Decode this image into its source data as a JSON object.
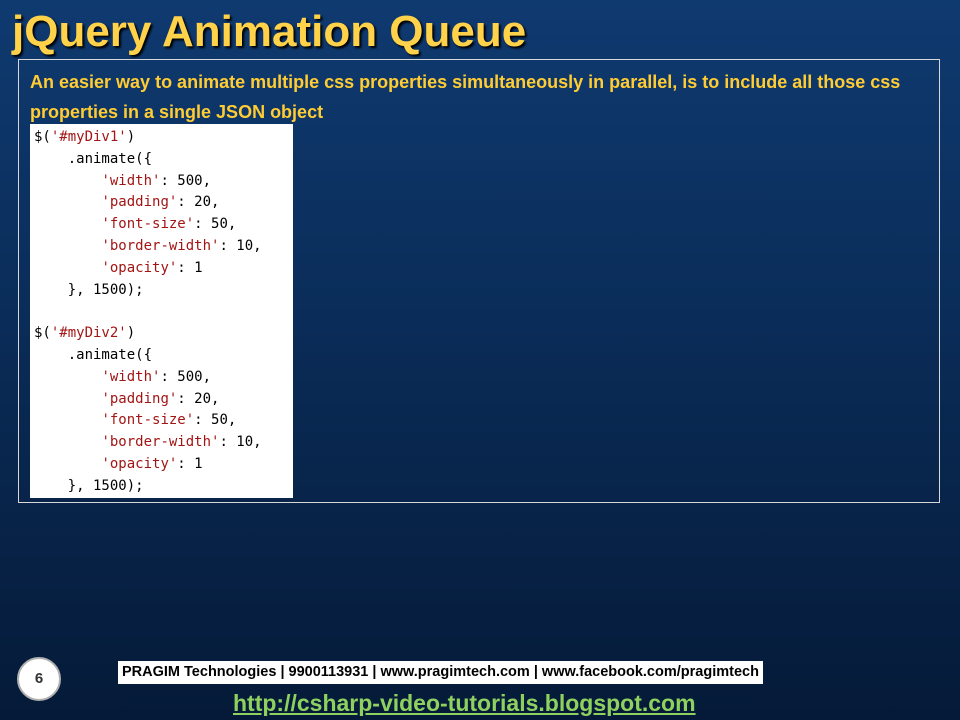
{
  "slide": {
    "title": "jQuery Animation Queue",
    "intro": "An easier way to animate multiple css properties simultaneously in parallel, is to include all those css properties in a single JSON object",
    "code_lines": [
      [
        {
          "t": "$("
        },
        {
          "t": "'#myDiv1'",
          "s": true
        },
        {
          "t": ")"
        }
      ],
      [
        {
          "t": "    .animate({"
        }
      ],
      [
        {
          "t": "        "
        },
        {
          "t": "'width'",
          "s": true
        },
        {
          "t": ": 500,"
        }
      ],
      [
        {
          "t": "        "
        },
        {
          "t": "'padding'",
          "s": true
        },
        {
          "t": ": 20,"
        }
      ],
      [
        {
          "t": "        "
        },
        {
          "t": "'font-size'",
          "s": true
        },
        {
          "t": ": 50,"
        }
      ],
      [
        {
          "t": "        "
        },
        {
          "t": "'border-width'",
          "s": true
        },
        {
          "t": ": 10,"
        }
      ],
      [
        {
          "t": "        "
        },
        {
          "t": "'opacity'",
          "s": true
        },
        {
          "t": ": 1"
        }
      ],
      [
        {
          "t": "    }, 1500);"
        }
      ],
      [],
      [
        {
          "t": "$("
        },
        {
          "t": "'#myDiv2'",
          "s": true
        },
        {
          "t": ")"
        }
      ],
      [
        {
          "t": "    .animate({"
        }
      ],
      [
        {
          "t": "        "
        },
        {
          "t": "'width'",
          "s": true
        },
        {
          "t": ": 500,"
        }
      ],
      [
        {
          "t": "        "
        },
        {
          "t": "'padding'",
          "s": true
        },
        {
          "t": ": 20,"
        }
      ],
      [
        {
          "t": "        "
        },
        {
          "t": "'font-size'",
          "s": true
        },
        {
          "t": ": 50,"
        }
      ],
      [
        {
          "t": "        "
        },
        {
          "t": "'border-width'",
          "s": true
        },
        {
          "t": ": 10,"
        }
      ],
      [
        {
          "t": "        "
        },
        {
          "t": "'opacity'",
          "s": true
        },
        {
          "t": ": 1"
        }
      ],
      [
        {
          "t": "    }, 1500);"
        }
      ]
    ],
    "page_number": "6"
  },
  "footer": {
    "info": "PRAGIM Technologies | 9900113931 | www.pragimtech.com | www.facebook.com/pragimtech",
    "link": "http://csharp-video-tutorials.blogspot.com"
  },
  "colors": {
    "title": "#ffd24a",
    "intro": "#ffcc33",
    "code_string": "#a31515",
    "link": "#8ed15e"
  }
}
